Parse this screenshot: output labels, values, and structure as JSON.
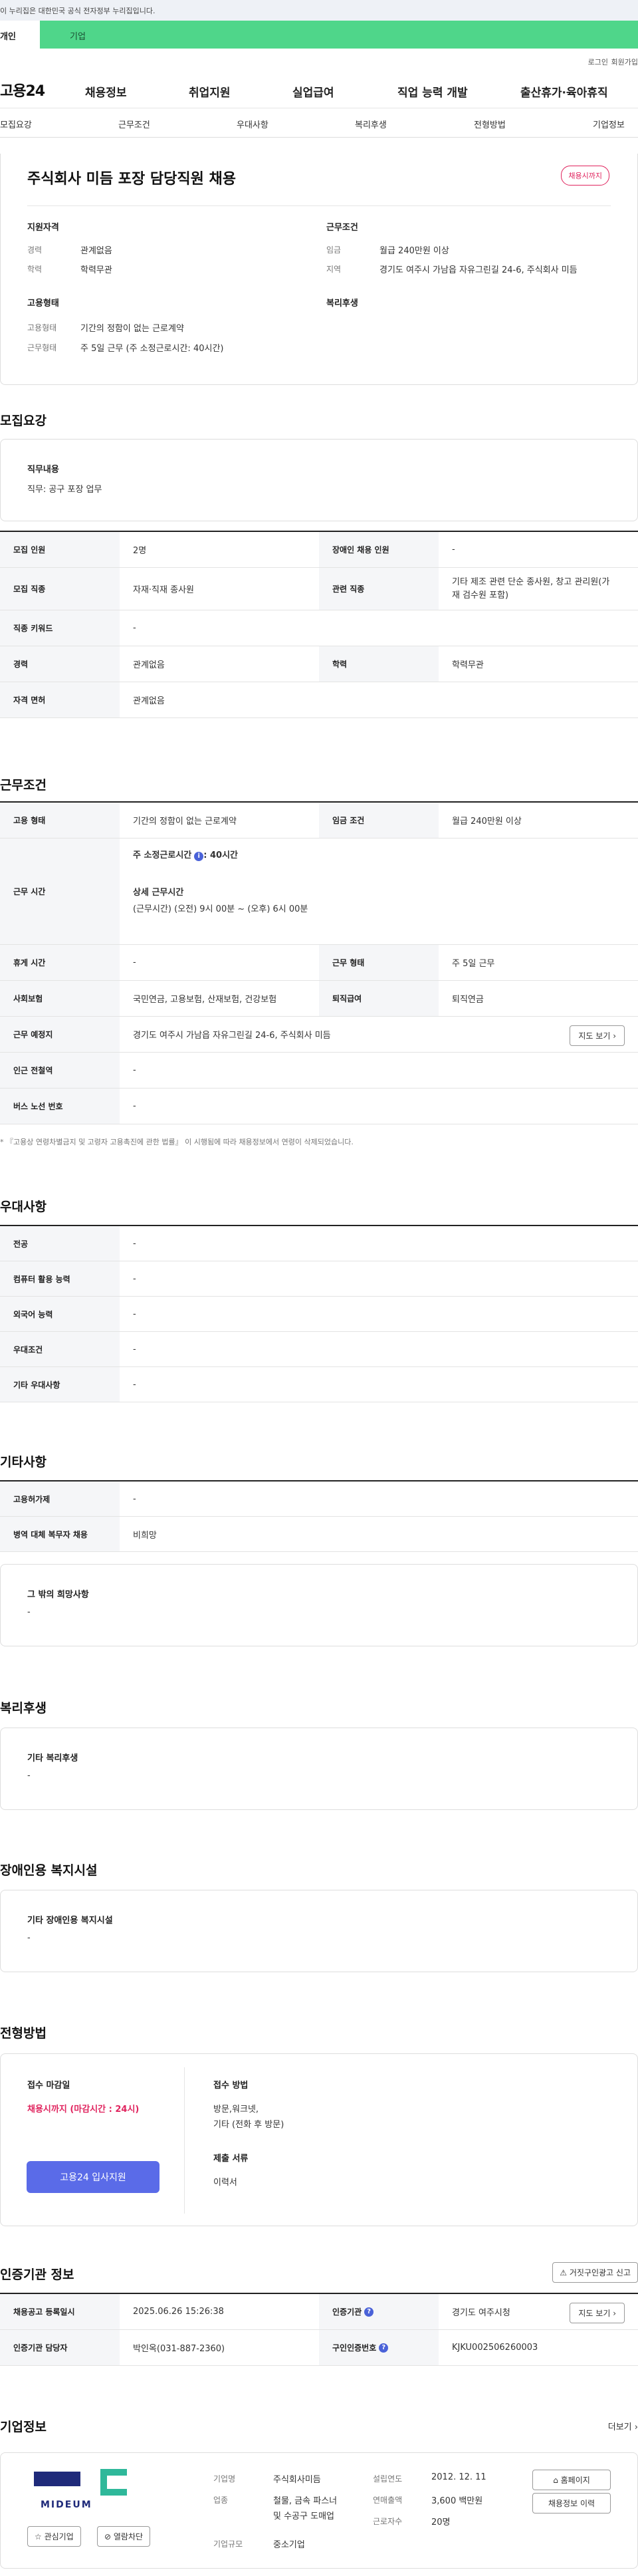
{
  "gov_banner": "이 누리집은 대한민국 공식 전자정부 누리집입니다.",
  "top_tabs": {
    "personal": "개인",
    "company": "기업"
  },
  "util": {
    "login": "로그인",
    "join": "회원가입"
  },
  "gnb": {
    "logo": "고용24",
    "menus": [
      "채용정보",
      "취업지원",
      "실업급여",
      "직업 능력 개발",
      "출산휴가·육아휴직"
    ]
  },
  "snb": [
    "모집요강",
    "근무조건",
    "우대사항",
    "복리후생",
    "전형방법",
    "기업정보"
  ],
  "job": {
    "title": "주식회사 미듬 포장 담당직원 채용",
    "badge": "채용시까지",
    "qual_title": "지원자격",
    "qual": [
      {
        "k": "경력",
        "v": "관계없음"
      },
      {
        "k": "학력",
        "v": "학력무관"
      }
    ],
    "cond_title": "근무조건",
    "cond": [
      {
        "k": "임금",
        "v": "월급 240만원 이상"
      },
      {
        "k": "지역",
        "v": "경기도 여주시 가남읍 자유그린길 24-6, 주식회사 미듬"
      }
    ],
    "emp_title": "고용형태",
    "emp": [
      {
        "k": "고용형태",
        "v": "기간의 정함이 없는 근로계약"
      },
      {
        "k": "근무형태",
        "v": "주 5일 근무 (주 소정근로시간: 40시간)"
      }
    ],
    "welfare_title": "복리후생"
  },
  "recruit": {
    "title": "모집요강",
    "duty_title": "직무내용",
    "duty_value": "직무: 공구 포장 업무",
    "rows": {
      "count_k": "모집 인원",
      "count_v": "2명",
      "disabled_k": "장애인 채용 인원",
      "disabled_v": "-",
      "job_k": "모집 직종",
      "job_v": "자재·직재 종사원",
      "related_k": "관련 직종",
      "related_v1": "기타 제조 관련 단순 종사원, 창고 관리원(가",
      "related_v2": "재 검수원 포함)",
      "keyword_k": "직종 키워드",
      "keyword_v": "-",
      "career_k": "경력",
      "career_v": "관계없음",
      "edu_k": "학력",
      "edu_v": "학력무관",
      "license_k": "자격 면허",
      "license_v": "관계없음"
    }
  },
  "work": {
    "title": "근무조건",
    "emp_k": "고용 형태",
    "emp_v": "기간의 정함이 없는 근로계약",
    "wage_k": "임금 조건",
    "wage_v": "월급 240만원 이상",
    "hours_k": "근무 시간",
    "hours_l1": "주 소정근로시간",
    "hours_l1b": ": 40시간",
    "hours_l2": "상세 근무시간",
    "hours_l3": "(근무시간) (오전) 9시 00분 ~ (오후) 6시 00분",
    "rest_k": "휴게 시간",
    "rest_v": "-",
    "form_k": "근무 형태",
    "form_v": "주 5일 근무",
    "ins_k": "사회보험",
    "ins_v": "국민연금, 고용보험, 산재보험, 건강보험",
    "retire_k": "퇴직급여",
    "retire_v": "퇴직연금",
    "place_k": "근무 예정지",
    "place_v": "경기도 여주시 가남읍 자유그린길 24-6, 주식회사 미듬",
    "map": "지도 보기",
    "subway_k": "인근 전철역",
    "subway_v": "-",
    "bus_k": "버스 노선 번호",
    "bus_v": "-",
    "note": "* 『고용상 연령차별금지 및 고령자 고용촉진에 관한 법률』 이 시행됨에 따라 채용정보에서 연령이 삭제되었습니다."
  },
  "prefer": {
    "title": "우대사항",
    "rows": [
      {
        "k": "전공",
        "v": "-"
      },
      {
        "k": "컴퓨터 활용 능력",
        "v": "-"
      },
      {
        "k": "외국어 능력",
        "v": "-"
      },
      {
        "k": "우대조건",
        "v": "-"
      },
      {
        "k": "기타 우대사항",
        "v": "-"
      }
    ]
  },
  "etc": {
    "title": "기타사항",
    "rows": [
      {
        "k": "고용허가제",
        "v": "-"
      },
      {
        "k": "병역 대체 복무자 채용",
        "v": "비희망"
      }
    ],
    "box_title": "그 밖의 희망사항",
    "box_value": "-"
  },
  "welfare": {
    "title": "복리후생",
    "box_title": "기타 복리후생",
    "box_value": "-"
  },
  "disabled": {
    "title": "장애인용 복지시설",
    "box_title": "기타 장애인용 복지시설",
    "box_value": "-"
  },
  "selection": {
    "title": "전형방법",
    "deadline_k": "접수 마감일",
    "deadline_v": "채용시까지 (마감시간 : 24시)",
    "apply_btn": "고용24 입사지원",
    "method_k": "접수 방법",
    "method_v1": "방문,워크넷,",
    "method_v2": "기타 (전화 후 방문)",
    "docs_k": "제출 서류",
    "docs_v": "이력서"
  },
  "agency": {
    "title": "인증기관 정보",
    "report_btn": "거짓구인광고 신고",
    "reg_k": "채용공고 등록일시",
    "reg_v": "2025.06.26 15:26:38",
    "org_k": "인증기관",
    "org_v": "경기도 여주시청",
    "map": "지도 보기",
    "staff_k": "인증기관 담당자",
    "staff_v": "박인옥(031-887-2360)",
    "no_k": "구인인증번호",
    "no_v": "KJKU002506260003"
  },
  "company": {
    "title": "기업정보",
    "more": "더보기",
    "logo_text": "MIDEUM",
    "fav": "관심기업",
    "block": "열람차단",
    "name_k": "기업명",
    "name_v": "주식회사미듬",
    "industry_k": "업종",
    "industry_v1": "철물, 금속 파스너",
    "industry_v2": "및 수공구 도매업",
    "scale_k": "기업규모",
    "scale_v": "중소기업",
    "founded_k": "설립연도",
    "founded_v": "2012. 12. 11",
    "sales_k": "연매출액",
    "sales_v": "3,600 백만원",
    "emps_k": "근로자수",
    "emps_v": "20명",
    "homepage": "홈페이지",
    "history": "채용정보 이력"
  }
}
